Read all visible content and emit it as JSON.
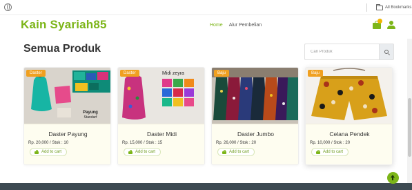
{
  "browser": {
    "all_bookmarks_label": "All Bookmarks",
    "icons": [
      "globe-icon",
      "folder-icon"
    ]
  },
  "header": {
    "brand": "Kain Syariah85",
    "nav": [
      {
        "label": "Home",
        "active": true
      },
      {
        "label": "Alur Pembelian",
        "active": false
      }
    ],
    "icons": [
      "cart-icon",
      "user-icon"
    ]
  },
  "main": {
    "title": "Semua Produk",
    "search": {
      "placeholder": "Cari Produk",
      "value": ""
    }
  },
  "products": [
    {
      "category": "Daster",
      "name": "Daster Payung",
      "meta": "Rp. 20,000 / Stok : 10",
      "add_label": "Add to cart",
      "image_caption": "Payung\nStandarf"
    },
    {
      "category": "Daster",
      "name": "Daster Midi",
      "meta": "Rp. 15,000 / Stok : 15",
      "add_label": "Add to cart",
      "image_caption": "Midi zeyra"
    },
    {
      "category": "Baju",
      "name": "Daster Jumbo",
      "meta": "Rp. 26,000 / Stok : 20",
      "add_label": "Add to cart",
      "image_caption": ""
    },
    {
      "category": "Baju",
      "name": "Celana Pendek",
      "meta": "Rp. 10,000 / Stok : 20",
      "add_label": "Add to cart",
      "image_caption": ""
    }
  ],
  "colors": {
    "brand_green": "#7cb518",
    "badge_orange": "#f0a020",
    "footer": "#3d4a52"
  }
}
